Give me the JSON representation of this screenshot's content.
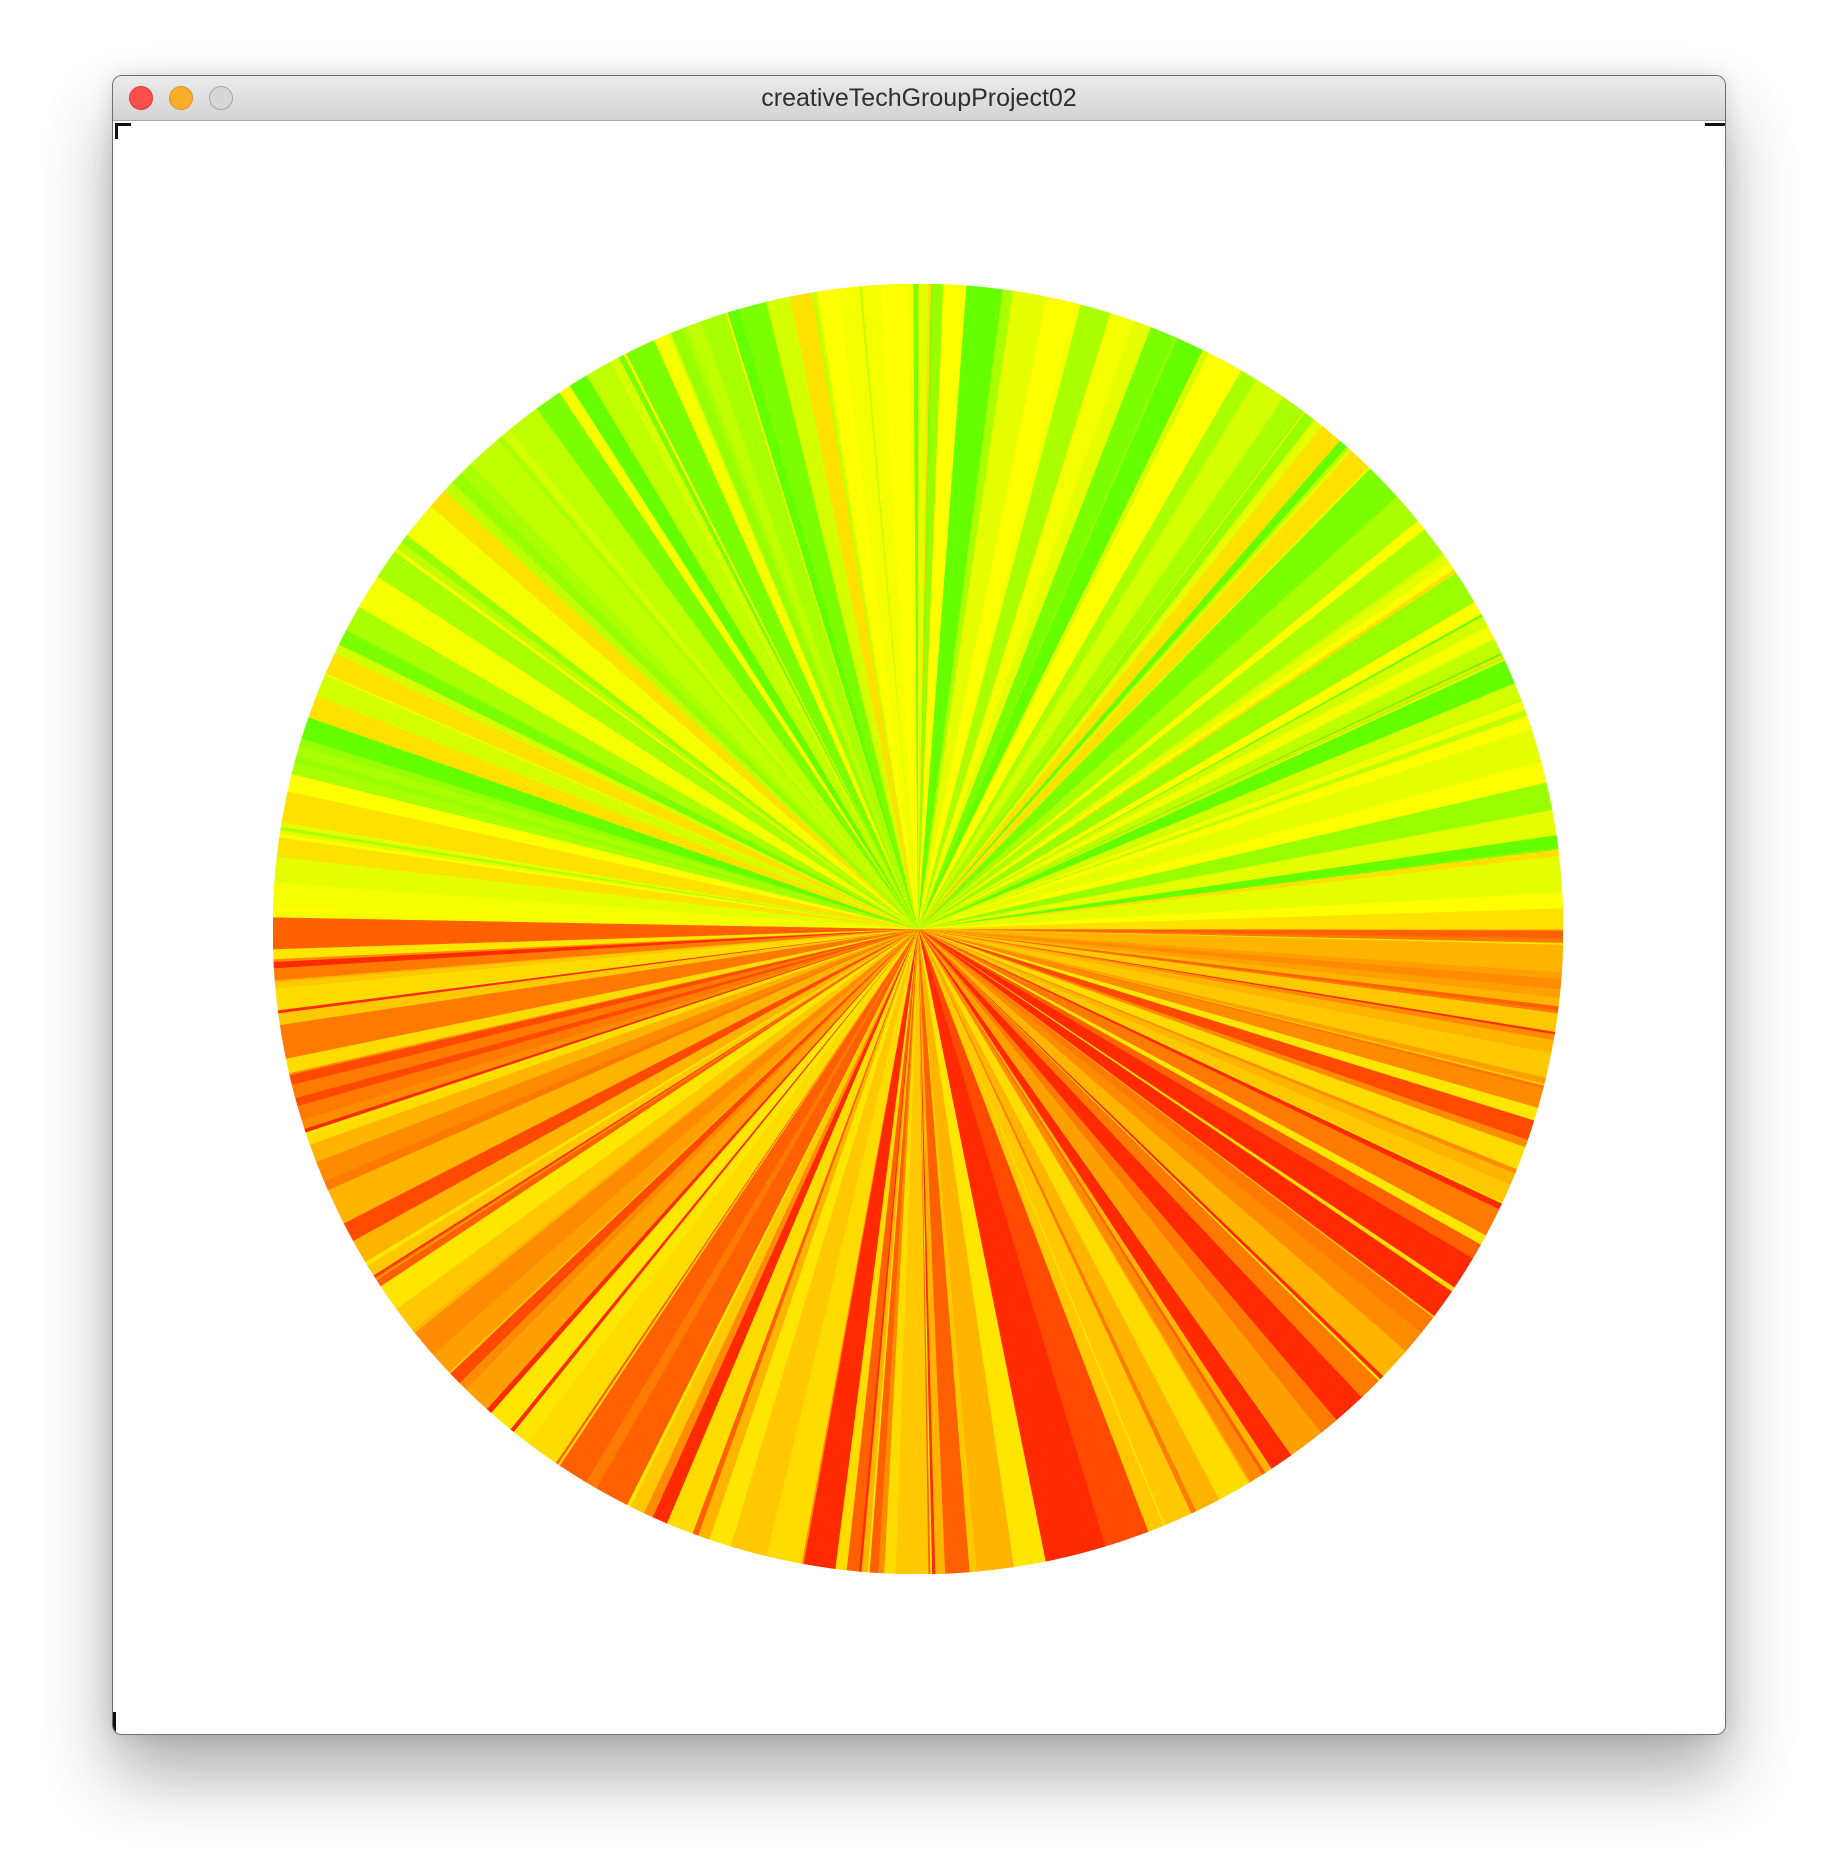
{
  "window": {
    "title": "creativeTechGroupProject02"
  },
  "sketch": {
    "type": "radial-burst-circle",
    "upper_palette": [
      "#66ff00",
      "#7cff00",
      "#99ff00",
      "#aaff00",
      "#bfff00",
      "#d4ff00",
      "#e5ff00",
      "#f5ff00",
      "#ffff00",
      "#ffe100"
    ],
    "lower_palette": [
      "#ff2a00",
      "#ff4a00",
      "#ff6000",
      "#ff7a00",
      "#ff8c00",
      "#ffa000",
      "#ffb400",
      "#ffc800",
      "#ffdc00",
      "#ffe600"
    ],
    "wedge_count": 300,
    "seed": 11
  }
}
